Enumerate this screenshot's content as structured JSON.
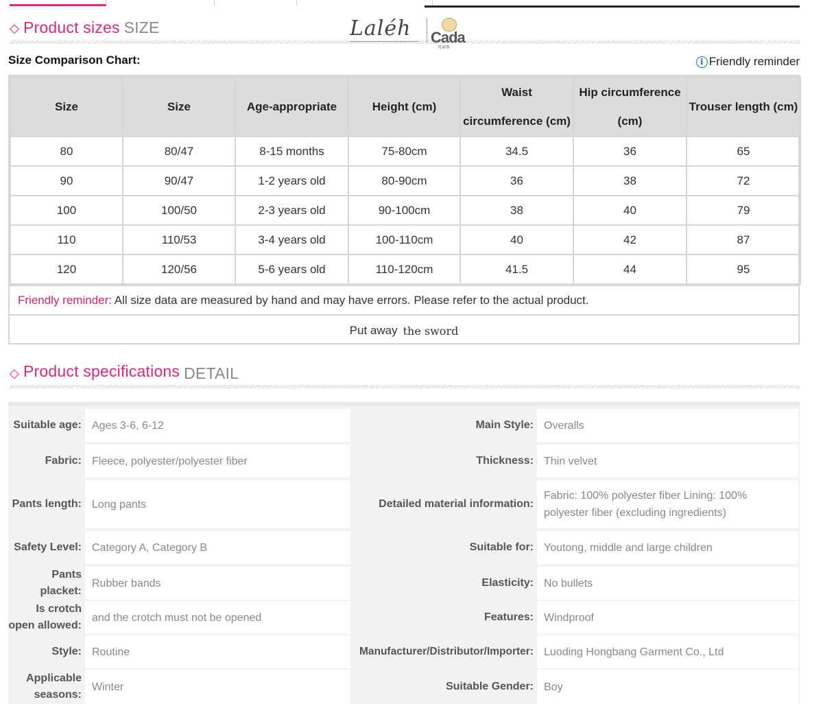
{
  "colors": {
    "accent": "#e0287c",
    "header_bg": "#dcdcdc",
    "spec_bg": "#f2f2f2",
    "info_blue": "#1a73c8"
  },
  "size_section": {
    "title": "Product sizes",
    "title_en": "SIZE",
    "diamond": "◇"
  },
  "logo": {
    "script": "Laléh",
    "brand": "Cada",
    "brand_sub": "可米熊"
  },
  "chart_label": "Size Comparison Chart:",
  "reminder_link": {
    "icon": "info-icon",
    "glyph": "i",
    "text": "Friendly reminder"
  },
  "size_table": {
    "headers": [
      {
        "lines": [
          "Size"
        ]
      },
      {
        "lines": [
          "Size"
        ]
      },
      {
        "lines": [
          "Age-appropriate"
        ]
      },
      {
        "lines": [
          "Height (cm)"
        ]
      },
      {
        "lines": [
          "Waist",
          "circumference (cm)"
        ]
      },
      {
        "lines": [
          "Hip circumference",
          "(cm)"
        ]
      },
      {
        "lines": [
          "Trouser length (cm)"
        ]
      }
    ],
    "rows": [
      [
        "80",
        "80/47",
        "8-15 months",
        "75-80cm",
        "34.5",
        "36",
        "65"
      ],
      [
        "90",
        "90/47",
        "1-2 years old",
        "80-90cm",
        "36",
        "38",
        "72"
      ],
      [
        "100",
        "100/50",
        "2-3 years old",
        "90-100cm",
        "38",
        "40",
        "79"
      ],
      [
        "110",
        "110/53",
        "3-4 years old",
        "100-110cm",
        "40",
        "42",
        "87"
      ],
      [
        "120",
        "120/56",
        "5-6 years old",
        "110-120cm",
        "41.5",
        "44",
        "95"
      ]
    ],
    "note_lead": "Friendly reminder:",
    "note_text": " All size data are measured by hand and may have errors. Please refer to the actual product.",
    "put_away": "Put away",
    "put_away_serif": "the sword"
  },
  "spec_section": {
    "title": "Product specifications",
    "title_en": "DETAIL",
    "diamond": "◇"
  },
  "specs": [
    {
      "left": {
        "label": "Suitable age:",
        "value": "Ages 3-6, 6-12"
      },
      "right": {
        "label": "Main Style:",
        "value": "Overalls"
      }
    },
    {
      "left": {
        "label": "Fabric:",
        "value": "Fleece, polyester/polyester fiber"
      },
      "right": {
        "label": "Thickness:",
        "value": "Thin velvet"
      }
    },
    {
      "left": {
        "label": "Pants length:",
        "value": "Long pants"
      },
      "right": {
        "label": "Detailed material information:",
        "value": "Fabric: 100% polyester fiber Lining: 100% polyester fiber (excluding ingredients)"
      }
    },
    {
      "left": {
        "label": "Safety Level:",
        "value": "Category A, Category B"
      },
      "right": {
        "label": "Suitable for:",
        "value": "Youtong, middle and large children"
      }
    },
    {
      "left": {
        "label": "Pants placket:",
        "value": "Rubber bands"
      },
      "right": {
        "label": "Elasticity:",
        "value": "No bullets"
      }
    },
    {
      "left": {
        "label": "Is crotch open allowed:",
        "value": "and the crotch must not be opened"
      },
      "right": {
        "label": "Features:",
        "value": "Windproof"
      }
    },
    {
      "left": {
        "label": "Style:",
        "value": "Routine"
      },
      "right": {
        "label": "Manufacturer/Distributor/Importer:",
        "value": "Luoding Hongbang Garment Co., Ltd"
      }
    },
    {
      "left": {
        "label": "Applicable seasons:",
        "value": "Winter"
      },
      "right": {
        "label": "Suitable Gender:",
        "value": "Boy"
      }
    }
  ]
}
